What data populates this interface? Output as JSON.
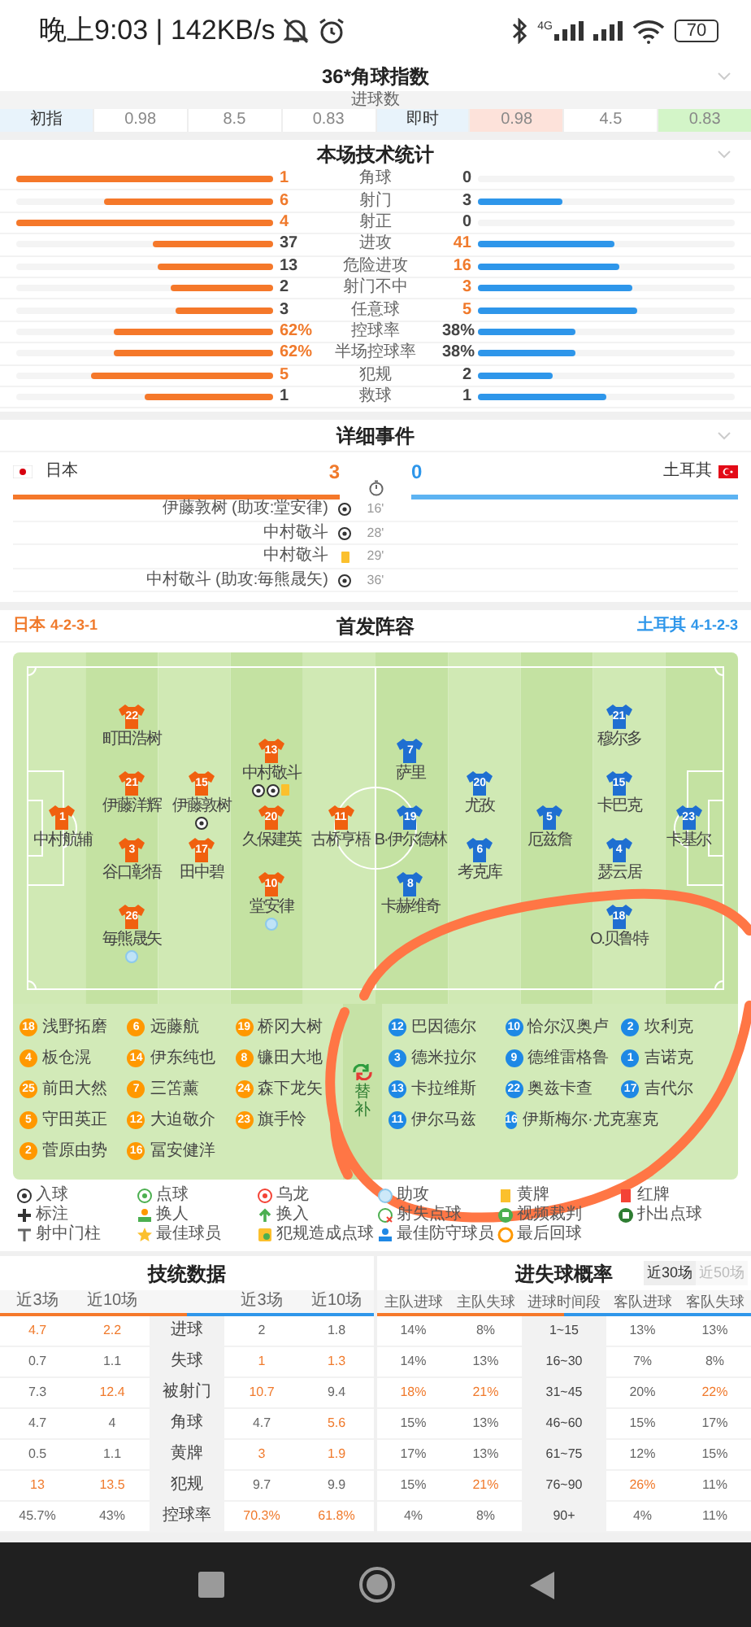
{
  "status_bar": {
    "text": "晚上9:03 | 142KB/s",
    "network": "4G",
    "battery": "70"
  },
  "corner_index": {
    "title": "36*角球指数",
    "subtitle": "进球数",
    "cells": [
      {
        "text": "初指",
        "kind": "label"
      },
      {
        "text": "0.98",
        "kind": "value"
      },
      {
        "text": "8.5",
        "kind": "value"
      },
      {
        "text": "0.83",
        "kind": "value"
      },
      {
        "text": "即时",
        "kind": "label"
      },
      {
        "text": "0.98",
        "kind": "down"
      },
      {
        "text": "4.5",
        "kind": "value"
      },
      {
        "text": "0.83",
        "kind": "up"
      }
    ]
  },
  "tech_stats": {
    "title": "本场技术统计",
    "rows": [
      {
        "label": "角球",
        "home": {
          "value": "1",
          "hot": true,
          "level": 1
        },
        "away": {
          "value": "0",
          "hot": false,
          "level": 0
        }
      },
      {
        "label": "射门",
        "home": {
          "value": "6",
          "hot": true,
          "level": 0.66
        },
        "away": {
          "value": "3",
          "hot": false,
          "level": 0.33
        }
      },
      {
        "label": "射正",
        "home": {
          "value": "4",
          "hot": true,
          "level": 1
        },
        "away": {
          "value": "0",
          "hot": false,
          "level": 0
        }
      },
      {
        "label": "进攻",
        "home": {
          "value": "37",
          "hot": false,
          "level": 0.47
        },
        "away": {
          "value": "41",
          "hot": true,
          "level": 0.53
        }
      },
      {
        "label": "危险进攻",
        "home": {
          "value": "13",
          "hot": false,
          "level": 0.45
        },
        "away": {
          "value": "16",
          "hot": true,
          "level": 0.55
        }
      },
      {
        "label": "射门不中",
        "home": {
          "value": "2",
          "hot": false,
          "level": 0.4
        },
        "away": {
          "value": "3",
          "hot": true,
          "level": 0.6
        }
      },
      {
        "label": "任意球",
        "home": {
          "value": "3",
          "hot": false,
          "level": 0.38
        },
        "away": {
          "value": "5",
          "hot": true,
          "level": 0.62
        }
      },
      {
        "label": "控球率",
        "home": {
          "value": "62%",
          "hot": true,
          "level": 0.62
        },
        "away": {
          "value": "38%",
          "hot": false,
          "level": 0.38
        }
      },
      {
        "label": "半场控球率",
        "home": {
          "value": "62%",
          "hot": true,
          "level": 0.62
        },
        "away": {
          "value": "38%",
          "hot": false,
          "level": 0.38
        }
      },
      {
        "label": "犯规",
        "home": {
          "value": "5",
          "hot": true,
          "level": 0.71
        },
        "away": {
          "value": "2",
          "hot": false,
          "level": 0.29
        }
      },
      {
        "label": "救球",
        "home": {
          "value": "1",
          "hot": false,
          "level": 0.5
        },
        "away": {
          "value": "1",
          "hot": false,
          "level": 0.5
        }
      }
    ]
  },
  "events": {
    "title": "详细事件",
    "home": {
      "name": "日本",
      "score": "3"
    },
    "away": {
      "name": "土耳其",
      "score": "0"
    },
    "items": [
      {
        "text": "伊藤敦树 (助攻:堂安律)",
        "kind": "goal",
        "minute": "16'"
      },
      {
        "text": "中村敬斗",
        "kind": "goal",
        "minute": "28'"
      },
      {
        "text": "中村敬斗",
        "kind": "yellow",
        "minute": "29'"
      },
      {
        "text": "中村敬斗 (助攻:毎熊晟矢)",
        "kind": "goal",
        "minute": "36'"
      }
    ]
  },
  "lineup": {
    "title": "首发阵容",
    "home": {
      "team": "日本",
      "formation": "4-2-3-1",
      "columns": [
        [
          {
            "number": "1",
            "name": "中村航辅"
          }
        ],
        [
          {
            "number": "22",
            "name": "町田浩树"
          },
          {
            "number": "21",
            "name": "伊藤洋辉"
          },
          {
            "number": "3",
            "name": "谷口彰悟"
          },
          {
            "number": "26",
            "name": "毎熊晟矢",
            "events": [
              {
                "kind": "assist"
              }
            ]
          }
        ],
        [
          {
            "number": "15",
            "name": "伊藤敦树",
            "events": [
              {
                "kind": "goal"
              }
            ]
          },
          {
            "number": "17",
            "name": "田中碧"
          }
        ],
        [
          {
            "number": "13",
            "name": "中村敬斗",
            "events": [
              {
                "kind": "goal"
              },
              {
                "kind": "goal"
              },
              {
                "kind": "yellow"
              }
            ]
          },
          {
            "number": "20",
            "name": "久保建英"
          },
          {
            "number": "10",
            "name": "堂安律",
            "events": [
              {
                "kind": "assist"
              }
            ]
          }
        ],
        [
          {
            "number": "11",
            "name": "古桥亨梧"
          }
        ]
      ]
    },
    "away": {
      "team": "土耳其",
      "formation": "4-1-2-3",
      "columns": [
        [
          {
            "number": "7",
            "name": "萨里"
          },
          {
            "number": "19",
            "name": "B·伊尔德林"
          },
          {
            "number": "8",
            "name": "卡赫维奇"
          }
        ],
        [
          {
            "number": "20",
            "name": "尤孜"
          },
          {
            "number": "6",
            "name": "考克库"
          }
        ],
        [
          {
            "number": "5",
            "name": "厄兹詹"
          }
        ],
        [
          {
            "number": "21",
            "name": "穆尔多"
          },
          {
            "number": "15",
            "name": "卡巴克"
          },
          {
            "number": "4",
            "name": "瑟云居"
          },
          {
            "number": "18",
            "name": "O.贝鲁特"
          }
        ],
        [
          {
            "number": "23",
            "name": "卡基尔"
          }
        ]
      ]
    }
  },
  "substitutes": {
    "label": "替补",
    "home": [
      {
        "number": "18",
        "name": "浅野拓磨"
      },
      {
        "number": "6",
        "name": "远藤航"
      },
      {
        "number": "19",
        "name": "桥冈大树"
      },
      {
        "number": "4",
        "name": "板仓滉"
      },
      {
        "number": "14",
        "name": "伊东纯也"
      },
      {
        "number": "8",
        "name": "镰田大地"
      },
      {
        "number": "25",
        "name": "前田大然"
      },
      {
        "number": "7",
        "name": "三笘薰"
      },
      {
        "number": "24",
        "name": "森下龙矢"
      },
      {
        "number": "5",
        "name": "守田英正"
      },
      {
        "number": "12",
        "name": "大迫敬介"
      },
      {
        "number": "23",
        "name": "旗手怜"
      },
      {
        "number": "2",
        "name": "菅原由势"
      },
      {
        "number": "16",
        "name": "冨安健洋"
      }
    ],
    "away": [
      {
        "number": "12",
        "name": "巴因德尔"
      },
      {
        "number": "10",
        "name": "恰尔汉奥卢"
      },
      {
        "number": "2",
        "name": "坎利克"
      },
      {
        "number": "3",
        "name": "德米拉尔"
      },
      {
        "number": "9",
        "name": "德维雷格鲁"
      },
      {
        "number": "1",
        "name": "吉诺克"
      },
      {
        "number": "13",
        "name": "卡拉维斯"
      },
      {
        "number": "22",
        "name": "奥兹卡查"
      },
      {
        "number": "17",
        "name": "吉代尔"
      },
      {
        "number": "11",
        "name": "伊尔马兹"
      },
      {
        "number": "16",
        "name": "伊斯梅尔·尤克塞克"
      }
    ]
  },
  "legend": [
    {
      "label": "入球",
      "kind": "goal"
    },
    {
      "label": "点球",
      "kind": "penalty"
    },
    {
      "label": "乌龙",
      "kind": "own_goal"
    },
    {
      "label": "助攻",
      "kind": "assist"
    },
    {
      "label": "黄牌",
      "kind": "yellow"
    },
    {
      "label": "红牌",
      "kind": "red"
    },
    {
      "label": "标注",
      "kind": "mark"
    },
    {
      "label": "换人",
      "kind": "sub"
    },
    {
      "label": "换入",
      "kind": "sub_in"
    },
    {
      "label": "射失点球",
      "kind": "missed_penalty"
    },
    {
      "label": "视频裁判",
      "kind": "var"
    },
    {
      "label": "扑出点球",
      "kind": "saved_penalty"
    },
    {
      "label": "射中门柱",
      "kind": "post"
    },
    {
      "label": "最佳球员",
      "kind": "best"
    },
    {
      "label": "犯规造成点球",
      "kind": "penalty_foul"
    },
    {
      "label": "最佳防守球员",
      "kind": "best_defender"
    },
    {
      "label": "最后回球",
      "kind": "last"
    }
  ],
  "team_stats": {
    "title": "技统数据",
    "columns": [
      "近3场",
      "近10场",
      "近3场",
      "近10场"
    ],
    "rows": [
      {
        "label": "进球",
        "cells": [
          {
            "text": "4.7",
            "hot": true
          },
          {
            "text": "2.2",
            "hot": true
          },
          {
            "text": "2",
            "hot": false
          },
          {
            "text": "1.8",
            "hot": false
          }
        ]
      },
      {
        "label": "失球",
        "cells": [
          {
            "text": "0.7",
            "hot": false
          },
          {
            "text": "1.1",
            "hot": false
          },
          {
            "text": "1",
            "hot": true
          },
          {
            "text": "1.3",
            "hot": true
          }
        ]
      },
      {
        "label": "被射门",
        "cells": [
          {
            "text": "7.3",
            "hot": false
          },
          {
            "text": "12.4",
            "hot": true
          },
          {
            "text": "10.7",
            "hot": true
          },
          {
            "text": "9.4",
            "hot": false
          }
        ]
      },
      {
        "label": "角球",
        "cells": [
          {
            "text": "4.7",
            "hot": false
          },
          {
            "text": "4",
            "hot": false
          },
          {
            "text": "4.7",
            "hot": false
          },
          {
            "text": "5.6",
            "hot": true
          }
        ]
      },
      {
        "label": "黄牌",
        "cells": [
          {
            "text": "0.5",
            "hot": false
          },
          {
            "text": "1.1",
            "hot": false
          },
          {
            "text": "3",
            "hot": true
          },
          {
            "text": "1.9",
            "hot": true
          }
        ]
      },
      {
        "label": "犯规",
        "cells": [
          {
            "text": "13",
            "hot": true
          },
          {
            "text": "13.5",
            "hot": true
          },
          {
            "text": "9.7",
            "hot": false
          },
          {
            "text": "9.9",
            "hot": false
          }
        ]
      },
      {
        "label": "控球率",
        "cells": [
          {
            "text": "45.7%",
            "hot": false
          },
          {
            "text": "43%",
            "hot": false
          },
          {
            "text": "70.3%",
            "hot": true
          },
          {
            "text": "61.8%",
            "hot": true
          }
        ]
      }
    ]
  },
  "goal_time": {
    "title": "进失球概率",
    "toggles": [
      {
        "label": "近30场",
        "selected": true
      },
      {
        "label": "近50场",
        "selected": false
      }
    ],
    "columns": [
      "主队进球",
      "主队失球",
      "进球时间段",
      "客队进球",
      "客队失球"
    ],
    "rows": [
      {
        "cells": [
          {
            "text": "14%",
            "hot": false
          },
          {
            "text": "8%",
            "hot": false
          },
          {
            "text": "1~15",
            "hot": false
          },
          {
            "text": "13%",
            "hot": false
          },
          {
            "text": "13%",
            "hot": false
          }
        ]
      },
      {
        "cells": [
          {
            "text": "14%",
            "hot": false
          },
          {
            "text": "13%",
            "hot": false
          },
          {
            "text": "16~30",
            "hot": false
          },
          {
            "text": "7%",
            "hot": false
          },
          {
            "text": "8%",
            "hot": false
          }
        ]
      },
      {
        "cells": [
          {
            "text": "18%",
            "hot": true
          },
          {
            "text": "21%",
            "hot": true
          },
          {
            "text": "31~45",
            "hot": false
          },
          {
            "text": "20%",
            "hot": false
          },
          {
            "text": "22%",
            "hot": true
          }
        ]
      },
      {
        "cells": [
          {
            "text": "15%",
            "hot": false
          },
          {
            "text": "13%",
            "hot": false
          },
          {
            "text": "46~60",
            "hot": false
          },
          {
            "text": "15%",
            "hot": false
          },
          {
            "text": "17%",
            "hot": false
          }
        ]
      },
      {
        "cells": [
          {
            "text": "17%",
            "hot": false
          },
          {
            "text": "13%",
            "hot": false
          },
          {
            "text": "61~75",
            "hot": false
          },
          {
            "text": "12%",
            "hot": false
          },
          {
            "text": "15%",
            "hot": false
          }
        ]
      },
      {
        "cells": [
          {
            "text": "15%",
            "hot": false
          },
          {
            "text": "21%",
            "hot": true
          },
          {
            "text": "76~90",
            "hot": false
          },
          {
            "text": "26%",
            "hot": true
          },
          {
            "text": "11%",
            "hot": false
          }
        ]
      },
      {
        "cells": [
          {
            "text": "4%",
            "hot": false
          },
          {
            "text": "8%",
            "hot": false
          },
          {
            "text": "90+",
            "hot": false
          },
          {
            "text": "4%",
            "hot": false
          },
          {
            "text": "11%",
            "hot": false
          }
        ]
      }
    ]
  }
}
